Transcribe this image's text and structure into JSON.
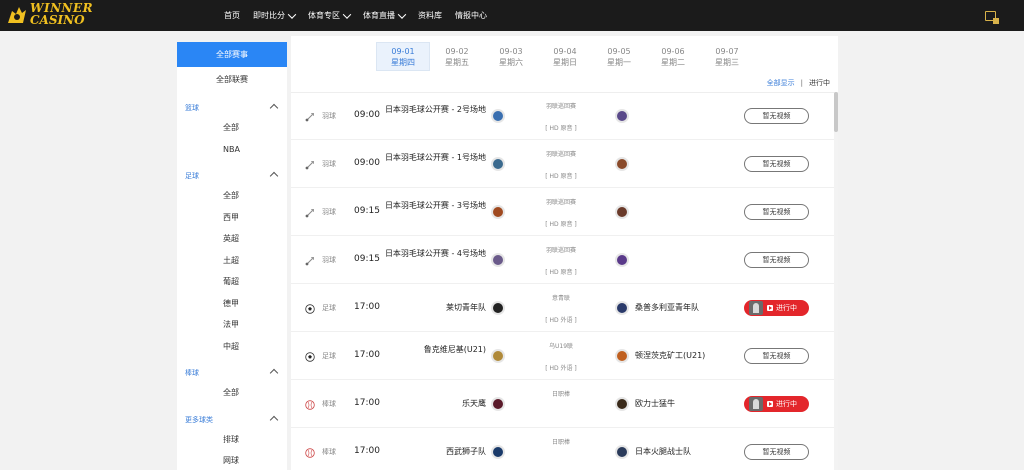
{
  "header": {
    "logo_line1": "WINNER",
    "logo_line2": "CASINO",
    "nav": [
      {
        "label": "首页",
        "dropdown": false
      },
      {
        "label": "即时比分",
        "dropdown": true
      },
      {
        "label": "体育专区",
        "dropdown": true
      },
      {
        "label": "体育直播",
        "dropdown": true
      },
      {
        "label": "资料库",
        "dropdown": false
      },
      {
        "label": "情报中心",
        "dropdown": false
      }
    ]
  },
  "sidebar": {
    "all_events": "全部赛事",
    "all_leagues": "全部联赛",
    "categories": [
      {
        "label": "篮球",
        "items": [
          "全部",
          "NBA"
        ]
      },
      {
        "label": "足球",
        "items": [
          "全部",
          "西甲",
          "英超",
          "土超",
          "葡超",
          "德甲",
          "法甲",
          "中超"
        ]
      },
      {
        "label": "棒球",
        "items": [
          "全部"
        ]
      },
      {
        "label": "更多球类",
        "items": [
          "排球",
          "网球"
        ]
      }
    ]
  },
  "dates": [
    {
      "date": "09-01",
      "weekday": "星期四",
      "active": true
    },
    {
      "date": "09-02",
      "weekday": "星期五",
      "active": false
    },
    {
      "date": "09-03",
      "weekday": "星期六",
      "active": false
    },
    {
      "date": "09-04",
      "weekday": "星期日",
      "active": false
    },
    {
      "date": "09-05",
      "weekday": "星期一",
      "active": false
    },
    {
      "date": "09-06",
      "weekday": "星期二",
      "active": false
    },
    {
      "date": "09-07",
      "weekday": "星期三",
      "active": false
    }
  ],
  "filter": {
    "all": "全部显示",
    "separator": "|",
    "live": "进行中"
  },
  "matches": [
    {
      "sport": "羽球",
      "sport_icon": "badminton",
      "time": "09:00",
      "home": "日本羽毛球公开赛 - 2号场地",
      "home_color": "#3a6fb0",
      "league": "羽联巡回赛",
      "stream": "[ HD 原音 ]",
      "away": "",
      "away_color": "#5a4a8a",
      "button": "暂无视频",
      "live": false
    },
    {
      "sport": "羽球",
      "sport_icon": "badminton",
      "time": "09:00",
      "home": "日本羽毛球公开赛 - 1号场地",
      "home_color": "#3b6a8e",
      "league": "羽联巡回赛",
      "stream": "[ HD 原音 ]",
      "away": "",
      "away_color": "#8a4a2a",
      "button": "暂无视频",
      "live": false
    },
    {
      "sport": "羽球",
      "sport_icon": "badminton",
      "time": "09:15",
      "home": "日本羽毛球公开赛 - 3号场地",
      "home_color": "#a04a20",
      "league": "羽联巡回赛",
      "stream": "[ HD 原音 ]",
      "away": "",
      "away_color": "#6a3a2a",
      "button": "暂无视频",
      "live": false
    },
    {
      "sport": "羽球",
      "sport_icon": "badminton",
      "time": "09:15",
      "home": "日本羽毛球公开赛 - 4号场地",
      "home_color": "#6a5a8a",
      "league": "羽联巡回赛",
      "stream": "[ HD 原音 ]",
      "away": "",
      "away_color": "#5a3a8a",
      "button": "暂无视频",
      "live": false
    },
    {
      "sport": "足球",
      "sport_icon": "soccer",
      "time": "17:00",
      "home": "莱切青年队",
      "home_color": "#222222",
      "league": "意青联",
      "stream": "[ HD 外语 ]",
      "away": "桑普多利亚青年队",
      "away_color": "#2a3a6a",
      "button": "进行中",
      "live": true
    },
    {
      "sport": "足球",
      "sport_icon": "soccer",
      "time": "17:00",
      "home": "鲁克维尼基(U21)",
      "home_color": "#b08a3a",
      "league": "乌U19联",
      "stream": "[ HD 外语 ]",
      "away": "顿涅茨克矿工(U21)",
      "away_color": "#c06020",
      "button": "暂无视频",
      "live": false
    },
    {
      "sport": "棒球",
      "sport_icon": "baseball",
      "time": "17:00",
      "home": "乐天鹰",
      "home_color": "#5a1a2a",
      "league": "日职棒",
      "stream": "",
      "away": "欧力士猛牛",
      "away_color": "#3a2a1a",
      "button": "进行中",
      "live": true
    },
    {
      "sport": "棒球",
      "sport_icon": "baseball",
      "time": "17:00",
      "home": "西武狮子队",
      "home_color": "#1a3a6a",
      "league": "日职棒",
      "stream": "",
      "away": "日本火腿战士队",
      "away_color": "#2a3a5a",
      "button": "暂无视频",
      "live": false
    }
  ]
}
